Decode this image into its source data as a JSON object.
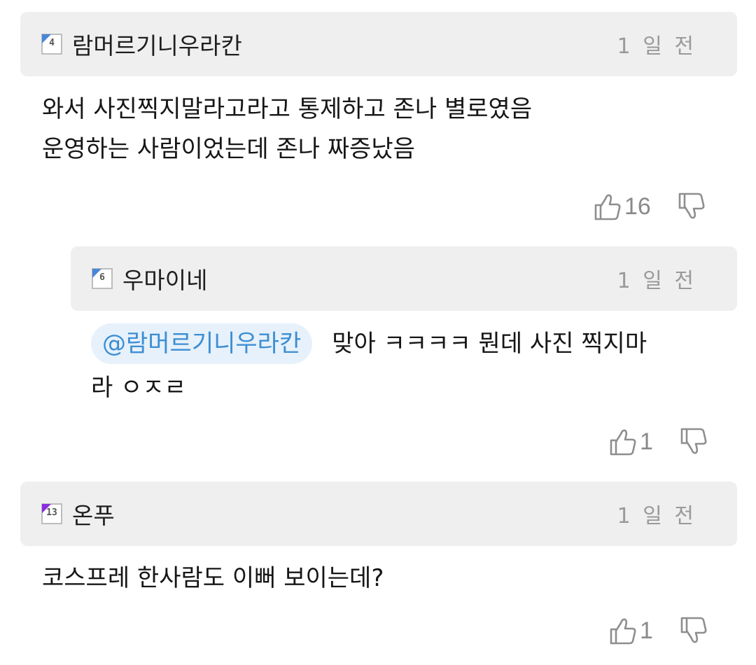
{
  "comments": [
    {
      "level": "4",
      "level_color": "#4a86d8",
      "nickname": "람머르기니우라칸",
      "time": "1 일 전",
      "lines": [
        "와서 사진찍지말라고라고 통제하고 존나 별로였음",
        "운영하는 사람이었는데 존나 짜증났음"
      ],
      "likes": "16"
    },
    {
      "level": "6",
      "level_color": "#4a86d8",
      "nickname": "우마이네",
      "time": "1 일 전",
      "mention": "@람머르기니우라칸",
      "lines": [
        "맞아 ㅋㅋㅋㅋ 뭔데 사진 찍지마",
        "라 ㅇㅈㄹ"
      ],
      "likes": "1"
    },
    {
      "level": "13",
      "level_color": "#8a2be2",
      "nickname": "온푸",
      "time": "1 일 전",
      "lines": [
        "코스프레 한사람도 이뻐 보이는데?"
      ],
      "likes": "1"
    }
  ]
}
